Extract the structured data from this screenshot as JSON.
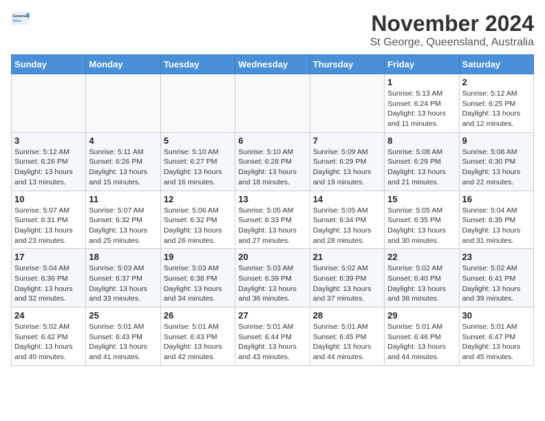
{
  "logo": {
    "general": "General",
    "blue": "Blue"
  },
  "title": "November 2024",
  "location": "St George, Queensland, Australia",
  "days_header": [
    "Sunday",
    "Monday",
    "Tuesday",
    "Wednesday",
    "Thursday",
    "Friday",
    "Saturday"
  ],
  "weeks": [
    [
      {
        "day": "",
        "info": ""
      },
      {
        "day": "",
        "info": ""
      },
      {
        "day": "",
        "info": ""
      },
      {
        "day": "",
        "info": ""
      },
      {
        "day": "",
        "info": ""
      },
      {
        "day": "1",
        "info": "Sunrise: 5:13 AM\nSunset: 6:24 PM\nDaylight: 13 hours\nand 11 minutes."
      },
      {
        "day": "2",
        "info": "Sunrise: 5:12 AM\nSunset: 6:25 PM\nDaylight: 13 hours\nand 12 minutes."
      }
    ],
    [
      {
        "day": "3",
        "info": "Sunrise: 5:12 AM\nSunset: 6:26 PM\nDaylight: 13 hours\nand 13 minutes."
      },
      {
        "day": "4",
        "info": "Sunrise: 5:11 AM\nSunset: 6:26 PM\nDaylight: 13 hours\nand 15 minutes."
      },
      {
        "day": "5",
        "info": "Sunrise: 5:10 AM\nSunset: 6:27 PM\nDaylight: 13 hours\nand 16 minutes."
      },
      {
        "day": "6",
        "info": "Sunrise: 5:10 AM\nSunset: 6:28 PM\nDaylight: 13 hours\nand 18 minutes."
      },
      {
        "day": "7",
        "info": "Sunrise: 5:09 AM\nSunset: 6:29 PM\nDaylight: 13 hours\nand 19 minutes."
      },
      {
        "day": "8",
        "info": "Sunrise: 5:08 AM\nSunset: 6:29 PM\nDaylight: 13 hours\nand 21 minutes."
      },
      {
        "day": "9",
        "info": "Sunrise: 5:08 AM\nSunset: 6:30 PM\nDaylight: 13 hours\nand 22 minutes."
      }
    ],
    [
      {
        "day": "10",
        "info": "Sunrise: 5:07 AM\nSunset: 6:31 PM\nDaylight: 13 hours\nand 23 minutes."
      },
      {
        "day": "11",
        "info": "Sunrise: 5:07 AM\nSunset: 6:32 PM\nDaylight: 13 hours\nand 25 minutes."
      },
      {
        "day": "12",
        "info": "Sunrise: 5:06 AM\nSunset: 6:32 PM\nDaylight: 13 hours\nand 26 minutes."
      },
      {
        "day": "13",
        "info": "Sunrise: 5:05 AM\nSunset: 6:33 PM\nDaylight: 13 hours\nand 27 minutes."
      },
      {
        "day": "14",
        "info": "Sunrise: 5:05 AM\nSunset: 6:34 PM\nDaylight: 13 hours\nand 28 minutes."
      },
      {
        "day": "15",
        "info": "Sunrise: 5:05 AM\nSunset: 6:35 PM\nDaylight: 13 hours\nand 30 minutes."
      },
      {
        "day": "16",
        "info": "Sunrise: 5:04 AM\nSunset: 6:35 PM\nDaylight: 13 hours\nand 31 minutes."
      }
    ],
    [
      {
        "day": "17",
        "info": "Sunrise: 5:04 AM\nSunset: 6:36 PM\nDaylight: 13 hours\nand 32 minutes."
      },
      {
        "day": "18",
        "info": "Sunrise: 5:03 AM\nSunset: 6:37 PM\nDaylight: 13 hours\nand 33 minutes."
      },
      {
        "day": "19",
        "info": "Sunrise: 5:03 AM\nSunset: 6:38 PM\nDaylight: 13 hours\nand 34 minutes."
      },
      {
        "day": "20",
        "info": "Sunrise: 5:03 AM\nSunset: 6:39 PM\nDaylight: 13 hours\nand 36 minutes."
      },
      {
        "day": "21",
        "info": "Sunrise: 5:02 AM\nSunset: 6:39 PM\nDaylight: 13 hours\nand 37 minutes."
      },
      {
        "day": "22",
        "info": "Sunrise: 5:02 AM\nSunset: 6:40 PM\nDaylight: 13 hours\nand 38 minutes."
      },
      {
        "day": "23",
        "info": "Sunrise: 5:02 AM\nSunset: 6:41 PM\nDaylight: 13 hours\nand 39 minutes."
      }
    ],
    [
      {
        "day": "24",
        "info": "Sunrise: 5:02 AM\nSunset: 6:42 PM\nDaylight: 13 hours\nand 40 minutes."
      },
      {
        "day": "25",
        "info": "Sunrise: 5:01 AM\nSunset: 6:43 PM\nDaylight: 13 hours\nand 41 minutes."
      },
      {
        "day": "26",
        "info": "Sunrise: 5:01 AM\nSunset: 6:43 PM\nDaylight: 13 hours\nand 42 minutes."
      },
      {
        "day": "27",
        "info": "Sunrise: 5:01 AM\nSunset: 6:44 PM\nDaylight: 13 hours\nand 43 minutes."
      },
      {
        "day": "28",
        "info": "Sunrise: 5:01 AM\nSunset: 6:45 PM\nDaylight: 13 hours\nand 44 minutes."
      },
      {
        "day": "29",
        "info": "Sunrise: 5:01 AM\nSunset: 6:46 PM\nDaylight: 13 hours\nand 44 minutes."
      },
      {
        "day": "30",
        "info": "Sunrise: 5:01 AM\nSunset: 6:47 PM\nDaylight: 13 hours\nand 45 minutes."
      }
    ]
  ]
}
